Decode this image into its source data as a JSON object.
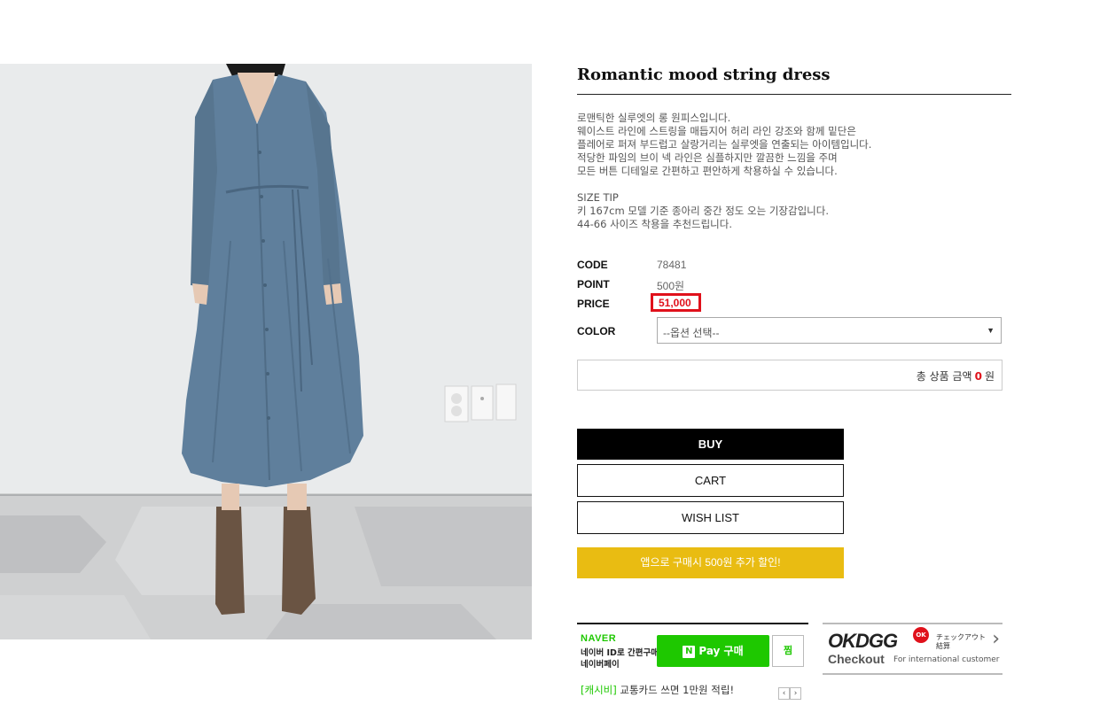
{
  "product": {
    "title": "Romantic mood string dress",
    "description": [
      "로맨틱한 실루엣의 롱 원피스입니다.",
      "웨이스트 라인에 스트링을 매듭지어 허리 라인 강조와 함께 밑단은",
      "플레어로 퍼져 부드럽고 살랑거리는 실루엣을 연출되는 아이템입니다.",
      "적당한 파임의 브이 넥 라인은 심플하지만 깔끔한 느낌을 주며",
      "모든 버튼 디테일로 간편하고 편안하게 착용하실 수 있습니다."
    ],
    "size_tip": [
      "SIZE TIP",
      "키 167cm 모델 기준 종아리 중간 정도 오는 기장감입니다.",
      "44-66 사이즈 착용을 추천드립니다."
    ]
  },
  "specs": {
    "code_label": "CODE",
    "code_value": "78481",
    "point_label": "POINT",
    "point_value": "500원",
    "price_label": "PRICE",
    "price_value": "51,000",
    "color_label": "COLOR",
    "color_placeholder": "--옵션 선택--"
  },
  "total": {
    "prefix": "총 상품 금액",
    "amount": "0",
    "suffix": "원"
  },
  "buttons": {
    "buy": "BUY",
    "cart": "CART",
    "wish": "WISH LIST",
    "app": "앱으로 구매시 500원 추가 할인!"
  },
  "naver": {
    "brand": "NAVER",
    "line1": "네이버 ID로 간편구매",
    "line2": "네이버페이",
    "pay_label": "Pay 구매",
    "pay_n": "N",
    "zzim": "찜"
  },
  "cashbee": {
    "tag": "[캐시비]",
    "text": "교통카드 쓰면 1만원 적립!",
    "prev": "‹",
    "next": "›"
  },
  "okdgg": {
    "logo": "OKDGG",
    "badge": "OK",
    "jp1": "チェックアウト",
    "jp2": "結算",
    "checkout": "Checkout",
    "intl": "For international customer"
  },
  "colors": {
    "accent_red": "#e0111b",
    "naver_green": "#1ec800",
    "app_yellow": "#e9bc12",
    "dress": "#5f7f9c"
  }
}
